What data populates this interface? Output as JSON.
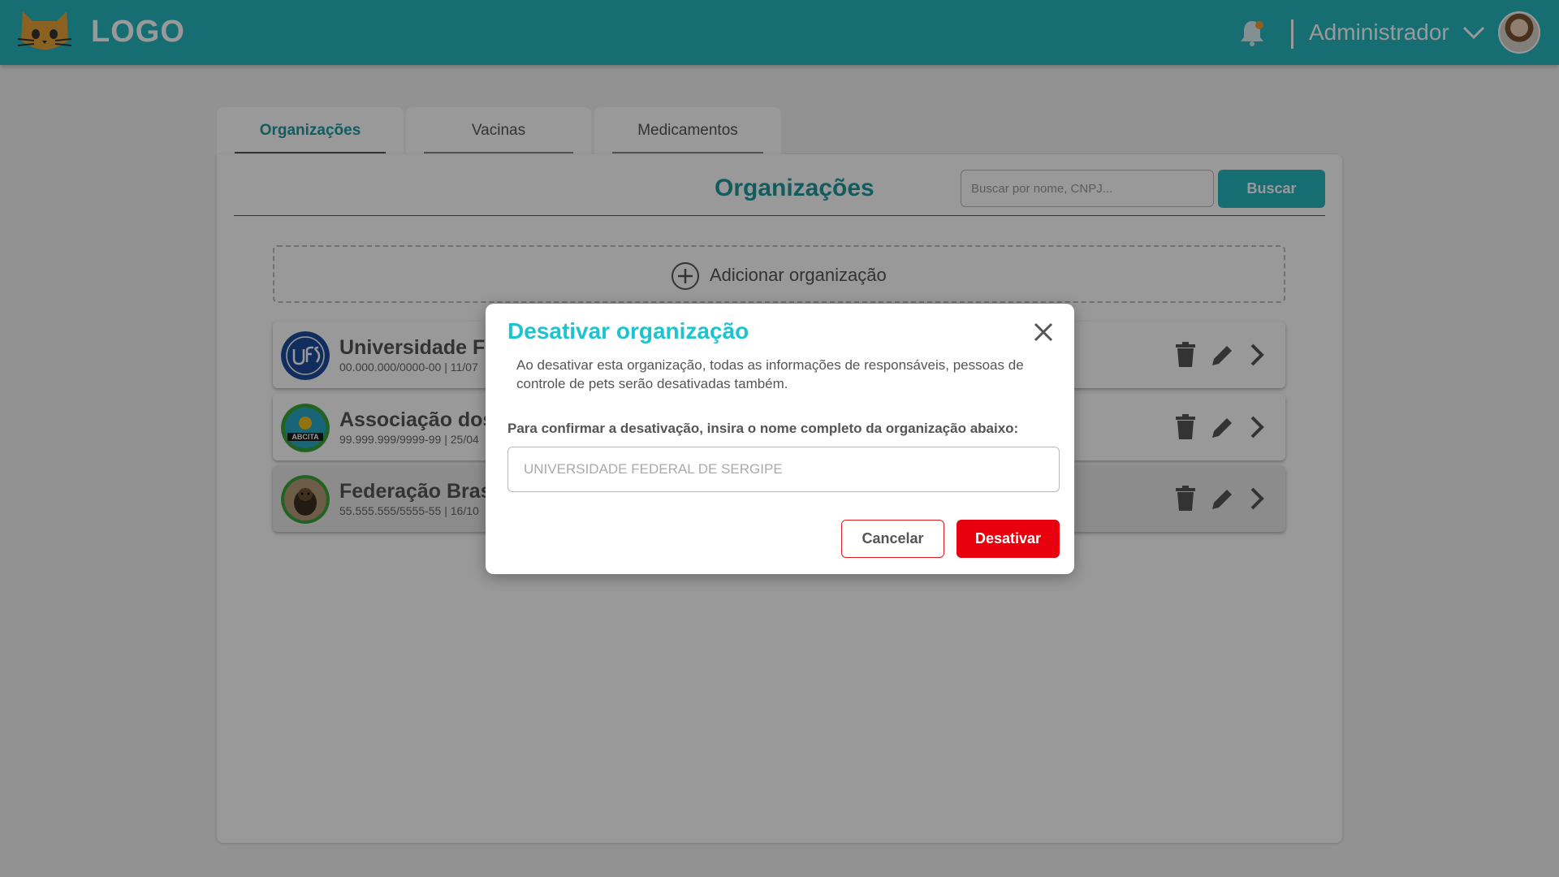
{
  "header": {
    "logo_text": "LOGO",
    "user_name": "Administrador",
    "icons": [
      "cat-logo-icon",
      "bell-icon",
      "chevron-down-icon",
      "avatar"
    ]
  },
  "tabs": [
    {
      "label": "Organizações",
      "active": true
    },
    {
      "label": "Vacinas",
      "active": false
    },
    {
      "label": "Medicamentos",
      "active": false
    }
  ],
  "main": {
    "title": "Organizações",
    "search": {
      "placeholder": "Buscar por nome, CNPJ...",
      "value": ""
    },
    "search_button": "Buscar",
    "add_label": "Adicionar organização",
    "organizations": [
      {
        "name": "Universidade Fed",
        "meta": "00.000.000/0000-00 | 11/07",
        "logo": "ufs-logo"
      },
      {
        "name": "Associação dos",
        "meta": "99.999.999/9999-99 | 25/04",
        "logo": "abcita-logo"
      },
      {
        "name": "Federação Brasil",
        "meta": "55.555.555/5555-55 | 16/10",
        "logo": "dog-photo"
      }
    ]
  },
  "modal": {
    "title": "Desativar organização",
    "description": "Ao desativar esta organização, todas as informações de responsáveis, pessoas de controle de pets serão desativadas também.",
    "confirm_label": "Para confirmar a desativação, insira o nome completo da organização abaixo:",
    "input_placeholder": "UNIVERSIDADE FEDERAL DE SERGIPE",
    "cancel_label": "Cancelar",
    "deactivate_label": "Desativar"
  },
  "colors": {
    "header_bg": "#26b8c0",
    "accent_teal": "#1e9aa1",
    "modal_title": "#1ec3d0",
    "danger": "#e8000e"
  }
}
